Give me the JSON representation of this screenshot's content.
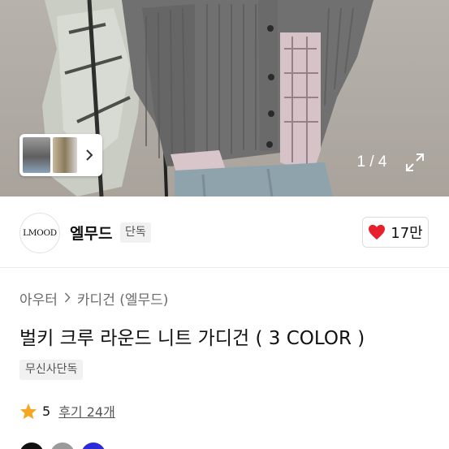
{
  "gallery": {
    "pager_text": "1 / 4",
    "thumb_labels": [
      "thumbnail-1",
      "thumbnail-2"
    ],
    "thumb_chevron_icon": "chevron-right-icon",
    "expand_icon": "expand-icon"
  },
  "brand": {
    "logo_text": "LMOOD",
    "name": "엘무드",
    "badge": "단독"
  },
  "like": {
    "icon": "heart-icon",
    "count": "17만",
    "heart_color": "#e8202a"
  },
  "breadcrumb": {
    "items": [
      "아우터",
      "카디건 (엘무드)"
    ],
    "separator_icon": "chevron-right-icon"
  },
  "product": {
    "title": "벌키 크루 라운드 니트 가디건 ( 3 COLOR )",
    "tag": "무신사단독"
  },
  "rating": {
    "icon": "star-icon",
    "star_color": "#f5a623",
    "score": "5",
    "review_text": "후기 24개"
  },
  "color_swatches": [
    {
      "name": "black",
      "color": "#111111"
    },
    {
      "name": "gray",
      "color": "#9a9a9a"
    },
    {
      "name": "blue",
      "color": "#2b2bd8"
    }
  ]
}
